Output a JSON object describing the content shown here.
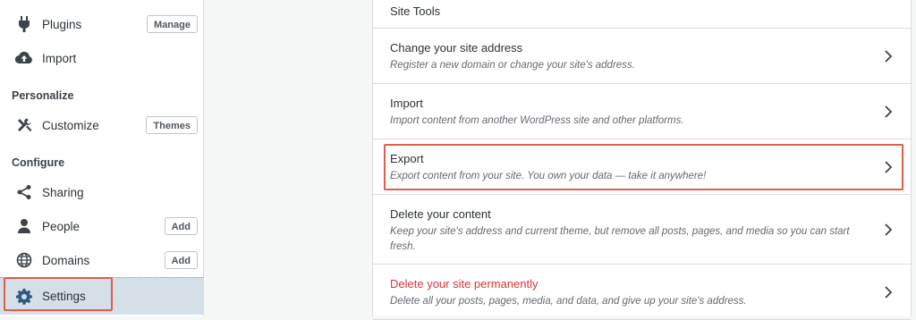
{
  "sidebar": {
    "plugins": {
      "label": "Plugins",
      "button": "Manage",
      "icon": "plug-icon"
    },
    "import": {
      "label": "Import",
      "icon": "cloud-upload-icon"
    },
    "personalize_heading": "Personalize",
    "customize": {
      "label": "Customize",
      "button": "Themes",
      "icon": "tools-icon"
    },
    "configure_heading": "Configure",
    "sharing": {
      "label": "Sharing",
      "icon": "share-icon"
    },
    "people": {
      "label": "People",
      "button": "Add",
      "icon": "person-icon"
    },
    "domains": {
      "label": "Domains",
      "button": "Add",
      "icon": "globe-icon"
    },
    "settings": {
      "label": "Settings",
      "icon": "gear-icon",
      "selected": true
    }
  },
  "site_tools": {
    "heading": "Site Tools",
    "rows": [
      {
        "title": "Change your site address",
        "description": "Register a new domain or change your site's address."
      },
      {
        "title": "Import",
        "description": "Import content from another WordPress site and other platforms."
      },
      {
        "title": "Export",
        "description": "Export content from your site. You own your data — take it anywhere!",
        "highlighted": true
      },
      {
        "title": "Delete your content",
        "description": "Keep your site's address and current theme, but remove all posts, pages, and media so you can start fresh."
      },
      {
        "title": "Delete your site permanently",
        "description": "Delete all your posts, pages, media, and data, and give up your site's address.",
        "danger": true
      }
    ]
  },
  "colors": {
    "highlight": "#e35b4a",
    "danger": "#d63638",
    "selected_bg": "#d5dfe8"
  }
}
